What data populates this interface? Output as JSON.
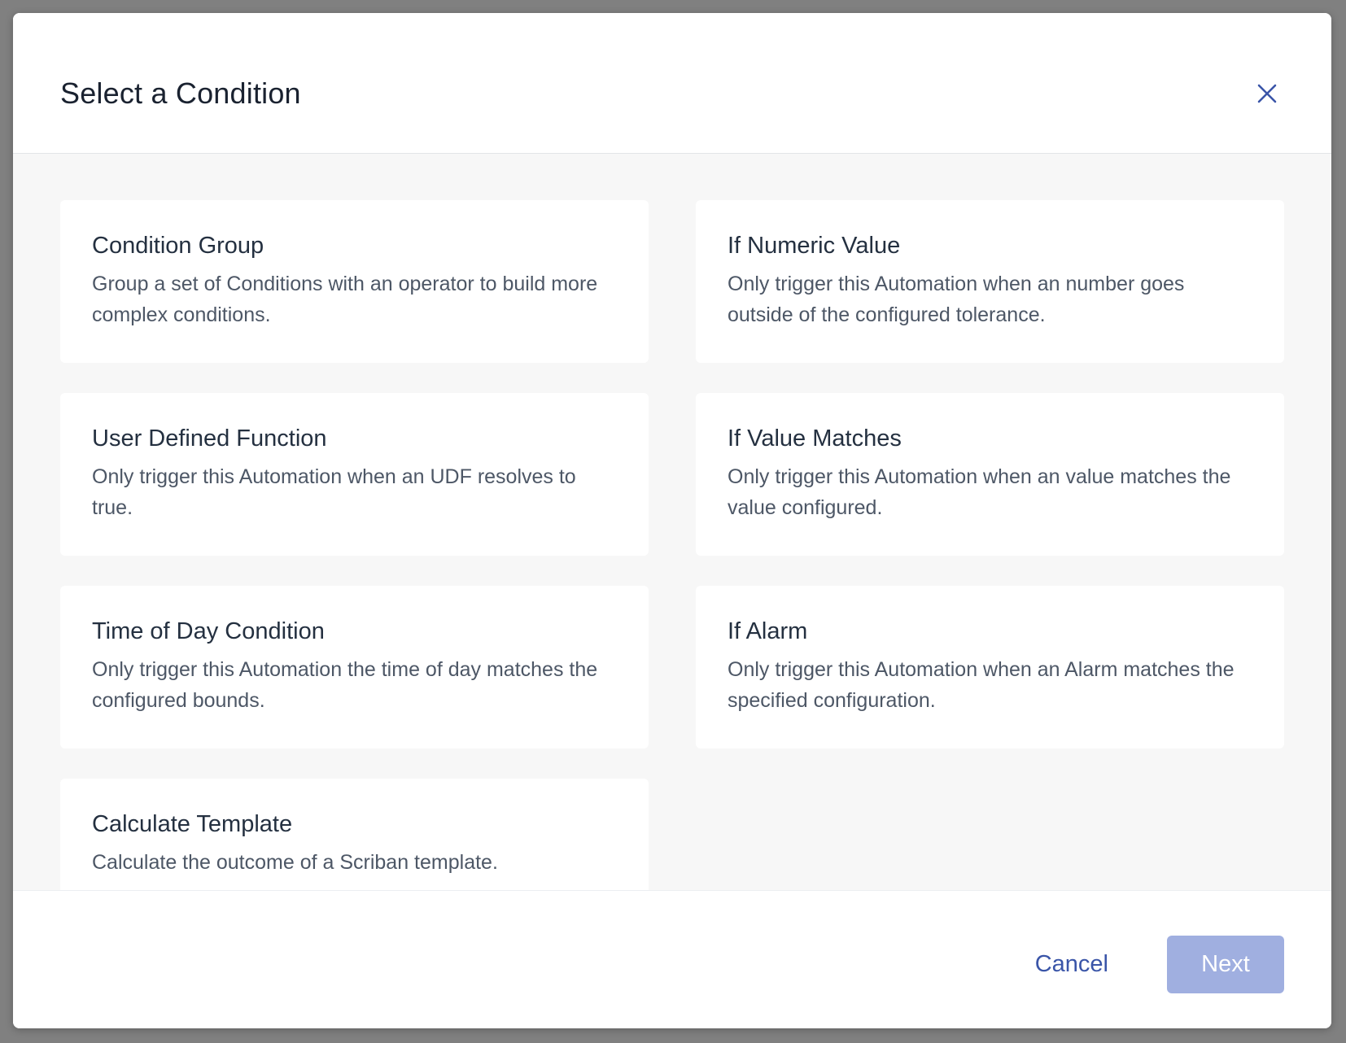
{
  "dialog": {
    "title": "Select a Condition",
    "close_icon": "close-icon"
  },
  "conditions": [
    {
      "title": "Condition Group",
      "description": "Group a set of Conditions with an operator to build more complex conditions."
    },
    {
      "title": "If Numeric Value",
      "description": "Only trigger this Automation when an number goes outside of the configured tolerance."
    },
    {
      "title": "User Defined Function",
      "description": "Only trigger this Automation when an UDF resolves to true."
    },
    {
      "title": "If Value Matches",
      "description": "Only trigger this Automation when an value matches the value configured."
    },
    {
      "title": "Time of Day Condition",
      "description": "Only trigger this Automation the time of day matches the configured bounds."
    },
    {
      "title": "If Alarm",
      "description": "Only trigger this Automation when an Alarm matches the specified configuration."
    },
    {
      "title": "Calculate Template",
      "description": "Calculate the outcome of a Scriban template."
    }
  ],
  "footer": {
    "cancel_label": "Cancel",
    "next_label": "Next",
    "next_disabled": true
  },
  "colors": {
    "backdrop": "#808080",
    "accent": "#3a55a8",
    "next_disabled_bg": "#a0afe0",
    "body_bg": "#f7f7f7"
  }
}
